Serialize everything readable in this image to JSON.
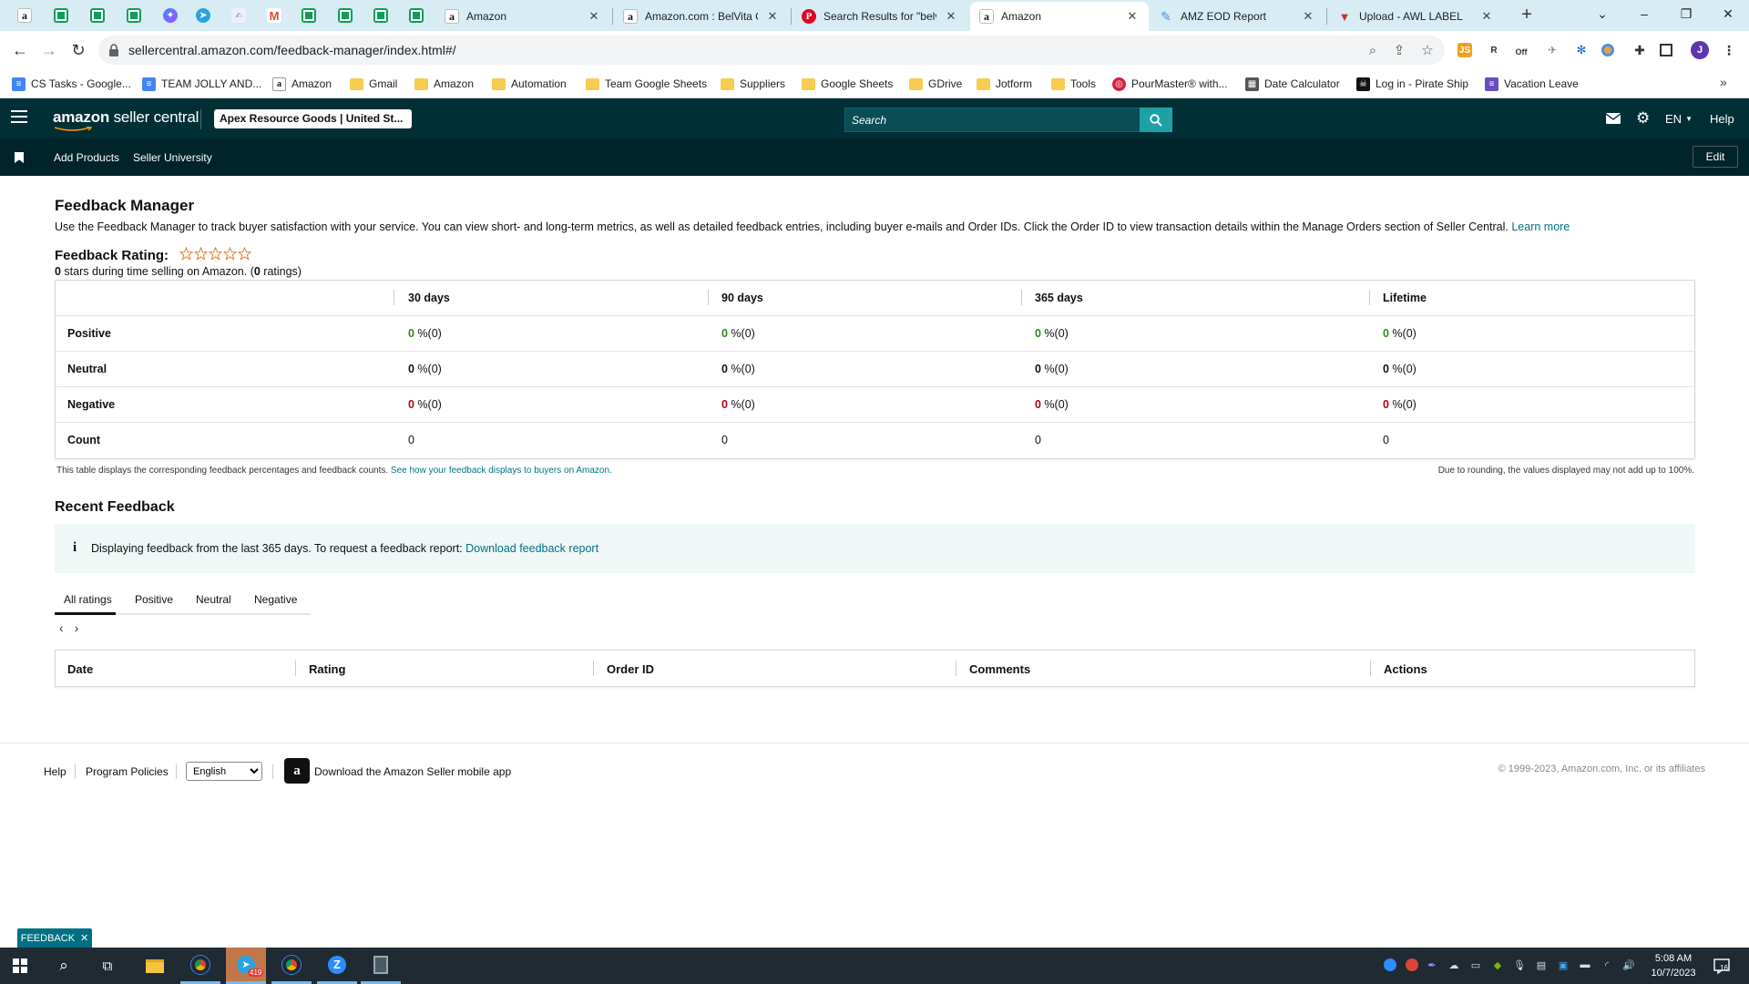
{
  "browser": {
    "tabs": [
      {
        "title": "Amazon",
        "icon": "amazon-icon",
        "active": false
      },
      {
        "title": "Amazon.com : BelVita C",
        "icon": "amazon-icon",
        "active": false
      },
      {
        "title": "Search Results for \"belvi",
        "icon": "pinterest-icon",
        "active": false
      },
      {
        "title": "Amazon",
        "icon": "amazon-icon",
        "active": true
      },
      {
        "title": "AMZ EOD Report",
        "icon": "pen-icon",
        "active": false
      },
      {
        "title": "Upload - AWL LABEL",
        "icon": "awl-icon",
        "active": false
      }
    ],
    "url": "sellercentral.amazon.com/feedback-manager/index.html#/",
    "bookmarks": [
      {
        "label": "CS Tasks - Google...",
        "icon": "docs-icon"
      },
      {
        "label": "TEAM JOLLY AND...",
        "icon": "docs-icon"
      },
      {
        "label": "Amazon",
        "icon": "amazon-icon"
      },
      {
        "label": "Gmail",
        "icon": "folder-icon"
      },
      {
        "label": "Amazon",
        "icon": "folder-icon"
      },
      {
        "label": "Automation",
        "icon": "folder-icon"
      },
      {
        "label": "Team Google Sheets",
        "icon": "folder-icon"
      },
      {
        "label": "Suppliers",
        "icon": "folder-icon"
      },
      {
        "label": "Google Sheets",
        "icon": "folder-icon"
      },
      {
        "label": "GDrive",
        "icon": "folder-icon"
      },
      {
        "label": "Jotform",
        "icon": "folder-icon"
      },
      {
        "label": "Tools",
        "icon": "folder-icon"
      },
      {
        "label": "PourMaster® with...",
        "icon": "pourmaster-icon"
      },
      {
        "label": "Date Calculator",
        "icon": "calculator-icon"
      },
      {
        "label": "Log in - Pirate Ship",
        "icon": "pirate-ship-icon"
      },
      {
        "label": "Vacation Leave",
        "icon": "form-icon"
      }
    ],
    "profile_initial": "J",
    "ext_badge": "Off"
  },
  "header": {
    "logo_bold": "amazon",
    "logo_rest": " seller central",
    "store": "Apex Resource Goods | United St...",
    "search_placeholder": "Search",
    "language": "EN",
    "help": "Help"
  },
  "nav": {
    "links": [
      "Add Products",
      "Seller University"
    ],
    "edit": "Edit"
  },
  "page": {
    "title": "Feedback Manager",
    "intro": "Use the Feedback Manager to track buyer satisfaction with your service. You can view short- and long-term metrics, as well as detailed feedback entries, including buyer e-mails and Order IDs. Click the Order ID to view transaction details within the Manage Orders section of Seller Central.",
    "learn_more": "Learn more",
    "rating_label": "Feedback Rating:",
    "stars_filled": 0,
    "stars_total": 5,
    "summary_stars": "0",
    "summary_mid": " stars during time selling on Amazon. (",
    "summary_count": "0",
    "summary_end": " ratings)"
  },
  "metrics": {
    "columns": [
      "30 days",
      "90 days",
      "365 days",
      "Lifetime"
    ],
    "rows": [
      {
        "label": "Positive",
        "cells": [
          {
            "pct": "0",
            "rest": " %(0)"
          },
          {
            "pct": "0",
            "rest": " %(0)"
          },
          {
            "pct": "0",
            "rest": " %(0)"
          },
          {
            "pct": "0",
            "rest": " %(0)"
          }
        ]
      },
      {
        "label": "Neutral",
        "cells": [
          {
            "pct": "0",
            "rest": " %(0)"
          },
          {
            "pct": "0",
            "rest": " %(0)"
          },
          {
            "pct": "0",
            "rest": " %(0)"
          },
          {
            "pct": "0",
            "rest": " %(0)"
          }
        ]
      },
      {
        "label": "Negative",
        "cells": [
          {
            "pct": "0",
            "rest": " %(0)"
          },
          {
            "pct": "0",
            "rest": " %(0)"
          },
          {
            "pct": "0",
            "rest": " %(0)"
          },
          {
            "pct": "0",
            "rest": " %(0)"
          }
        ]
      },
      {
        "label": "Count",
        "cells": [
          {
            "pct": "",
            "rest": "0"
          },
          {
            "pct": "",
            "rest": "0"
          },
          {
            "pct": "",
            "rest": "0"
          },
          {
            "pct": "",
            "rest": "0"
          }
        ]
      }
    ],
    "note": "This table displays the corresponding feedback percentages and feedback counts.",
    "note_link": "See how your feedback displays to buyers on Amazon.",
    "rounding": "Due to rounding, the values displayed may not add up to 100%."
  },
  "recent": {
    "title": "Recent Feedback",
    "info": "Displaying feedback from the last 365 days. To request a feedback report:",
    "info_link": "Download feedback report",
    "tabs": [
      "All ratings",
      "Positive",
      "Neutral",
      "Negative"
    ],
    "columns": [
      "Date",
      "Rating",
      "Order ID",
      "Comments",
      "Actions"
    ]
  },
  "footer": {
    "help": "Help",
    "policies": "Program Policies",
    "language_selected": "English",
    "app_text": "Download the Amazon Seller mobile app",
    "copyright": "© 1999-2023, Amazon.com, Inc. or its affiliates",
    "feedback_tab": "FEEDBACK"
  },
  "taskbar": {
    "time": "5:08 AM",
    "date": "10/7/2023",
    "telegram_badge": "419",
    "notification_count": "16"
  },
  "colors": {
    "header_bg": "#002f36",
    "nav_bg": "#00242a",
    "search_btn": "#1ea0a6",
    "link": "#007185",
    "positive": "#2e8b19",
    "negative": "#b1050f"
  }
}
